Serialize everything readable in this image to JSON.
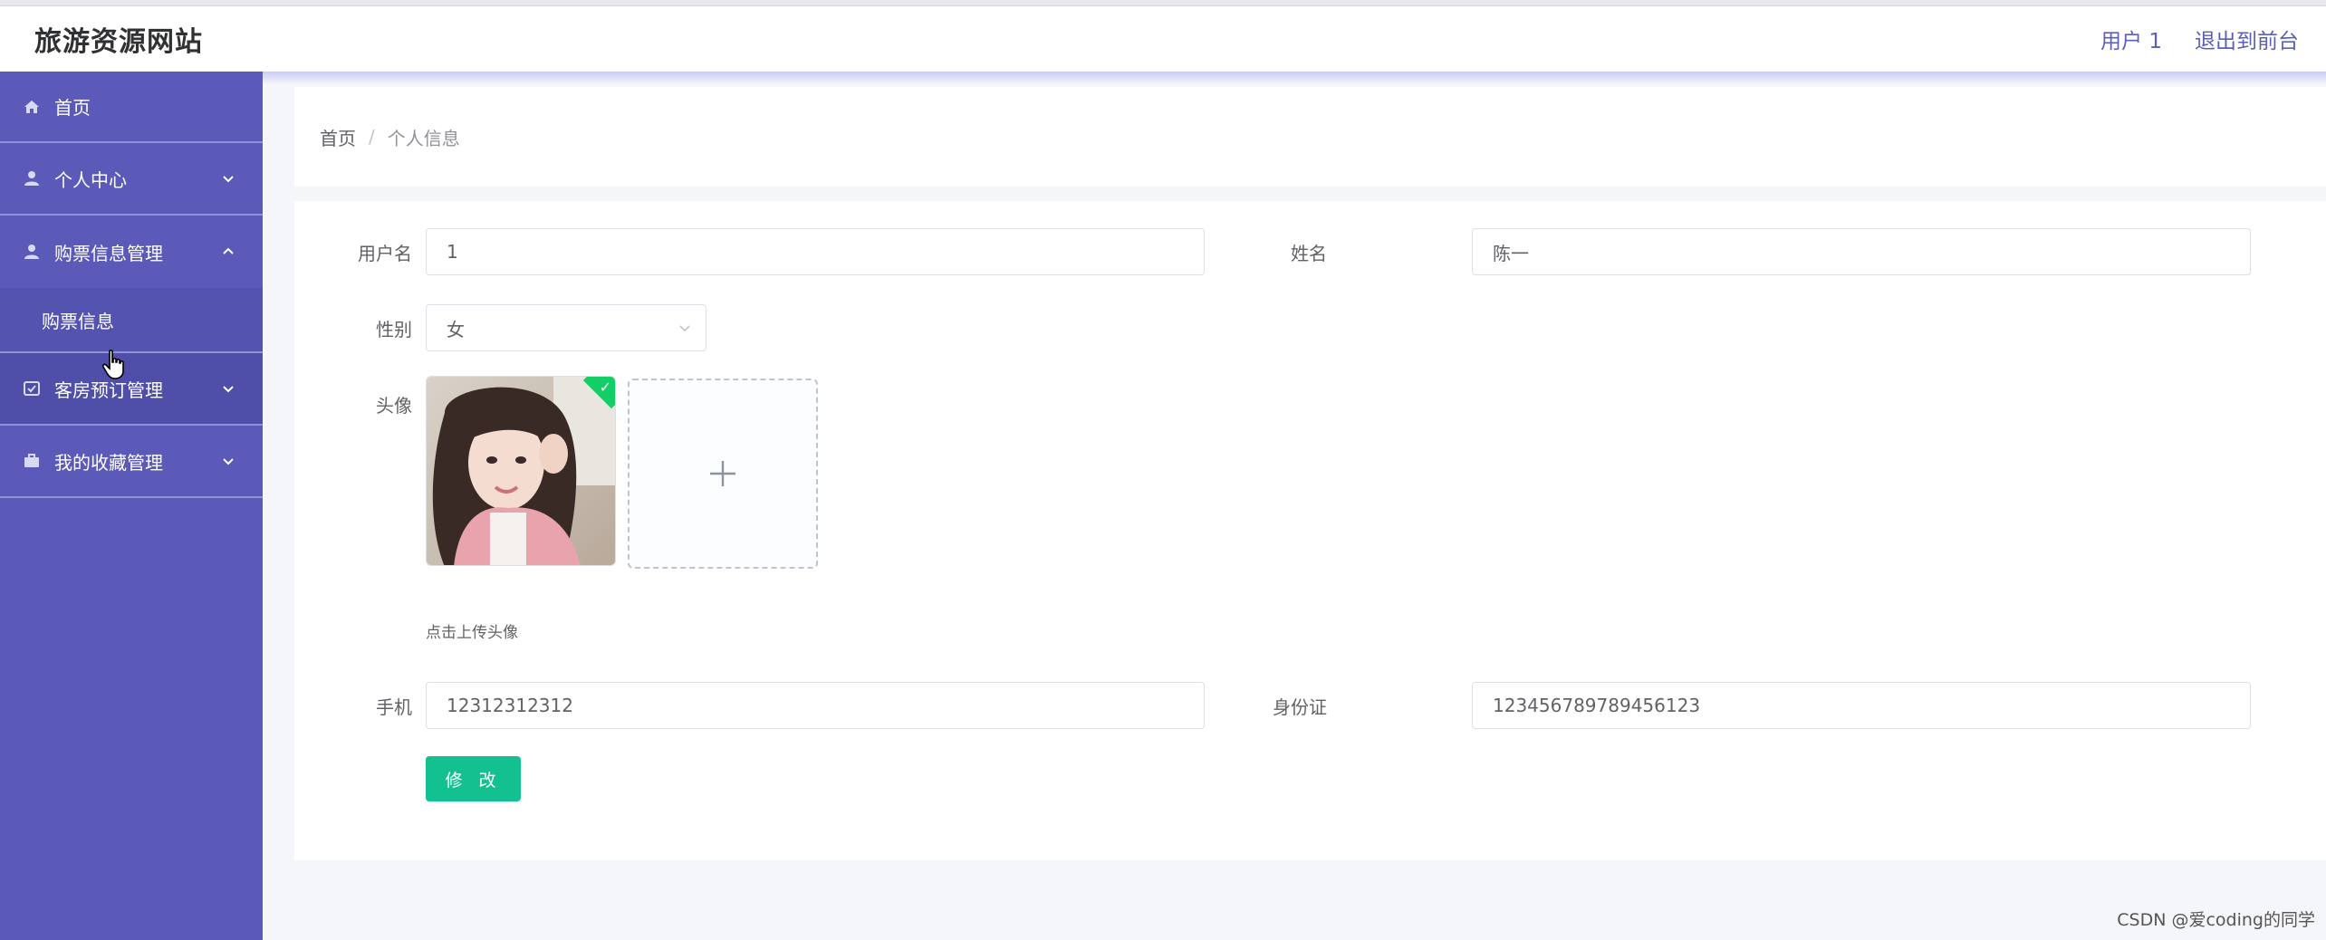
{
  "header": {
    "brand": "旅游资源网站",
    "user_label": "用户 1",
    "exit_label": "退出到前台"
  },
  "sidebar": {
    "items": [
      {
        "label": "首页",
        "icon": "home-icon"
      },
      {
        "label": "个人中心",
        "icon": "user-icon"
      },
      {
        "label": "购票信息管理",
        "icon": "user-icon",
        "expanded": true,
        "children": [
          {
            "label": "购票信息"
          }
        ]
      },
      {
        "label": "客房预订管理",
        "icon": "checkbox-icon"
      },
      {
        "label": "我的收藏管理",
        "icon": "briefcase-icon"
      }
    ]
  },
  "breadcrumb": {
    "home": "首页",
    "separator": "/",
    "current": "个人信息"
  },
  "form": {
    "username_label": "用户名",
    "username_value": "1",
    "name_label": "姓名",
    "name_value": "陈一",
    "gender_label": "性别",
    "gender_value": "女",
    "avatar_label": "头像",
    "upload_hint": "点击上传头像",
    "phone_label": "手机",
    "phone_value": "12312312312",
    "id_label": "身份证",
    "id_value": "123456789789456123",
    "submit_label": "修 改"
  },
  "watermark": "CSDN @爱coding的同学",
  "colors": {
    "sidebar": "#5b5ab8",
    "accent": "#5b5fb8",
    "button": "#13c08f"
  }
}
